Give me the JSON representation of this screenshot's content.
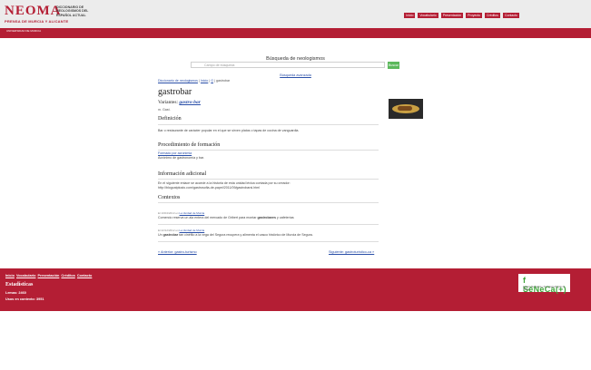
{
  "header": {
    "logo": "NEOMA",
    "tagline": "PRENSA DE MURCIA Y ALICANTE",
    "description": "DICCIONARIO DE NEOLOGISMOS DEL ESPAÑOL ACTUAL",
    "nav": [
      "Inicio",
      "Vocabulario",
      "Presentación",
      "Proyecto",
      "Créditos",
      "Contacto"
    ],
    "university": "UNIVERSIDAD DE MURCIA"
  },
  "search": {
    "title": "Búsqueda de neologismos",
    "placeholder": "Campo de búsqueda",
    "button": "Buscar",
    "advanced": "Búsqueda avanzada"
  },
  "entry": {
    "breadcrumb": {
      "root": "Diccionario de neologismos",
      "sep1": "|",
      "index": "Inicio",
      "sep2": "|",
      "letter": "G",
      "sep3": "|",
      "current": "gastrobar"
    },
    "title": "gastrobar",
    "variants_label": "Variantes:",
    "variant": "gastro-bar",
    "category": "m. Gast.",
    "definition_h": "Definición",
    "definition": "Bar o restaurante de carácter popular en el que se sirven platos o tapas de cocina de vanguardia.",
    "formation_h": "Procedimiento de formación",
    "formation_link": "Formado por acronimia",
    "formation_text": "Acrónimo de gastronomía y bar.",
    "extra_h": "Información adicional",
    "extra_text": "En el siguiente enlace se accede a la historia de esta unidad léxica contada por su creador:",
    "extra_url": "http://blogcatplusto.com/gastrosofia-de-papel/2011/09/gastrobarsi.html",
    "contexts_h": "Contextos",
    "contexts": [
      {
        "meta": "El 10/04/2013 en",
        "source": "La Verdad de Murcia",
        "before": "Comercio reserva un ala entera del mercado de Gribert para montar ",
        "term": "gastrobares",
        "after": " y cafeterías"
      },
      {
        "meta": "El 22/12/2012 en",
        "source": "La Verdad de Murcia",
        "before": "Un ",
        "term": "gastrobar",
        "after": " tan cinéfilo a la vega del Segura recupera y alimenta el casco histórico de Murcia de Segura."
      }
    ],
    "prev": "« Anterior: gastro-turismo",
    "next": "Siguiente: gastroturístico-ca »"
  },
  "footer": {
    "links": [
      "Inicio",
      "Vocabulario",
      "Presentación",
      "Créditos",
      "Contacto"
    ],
    "stats_h": "Estadísticas",
    "stat1_label": "Lemas:",
    "stat1_value": "2460",
    "stat2_label": "Usos en contexto:",
    "stat2_value": "3951",
    "sponsor_name": "f SéNeCa(+)",
    "sponsor_sub": "Agencia de Ciencia y Tecnología Región de Murcia"
  },
  "colors": {
    "brand": "#b41e34",
    "link": "#2a4fa8",
    "button": "#5cb85c"
  }
}
